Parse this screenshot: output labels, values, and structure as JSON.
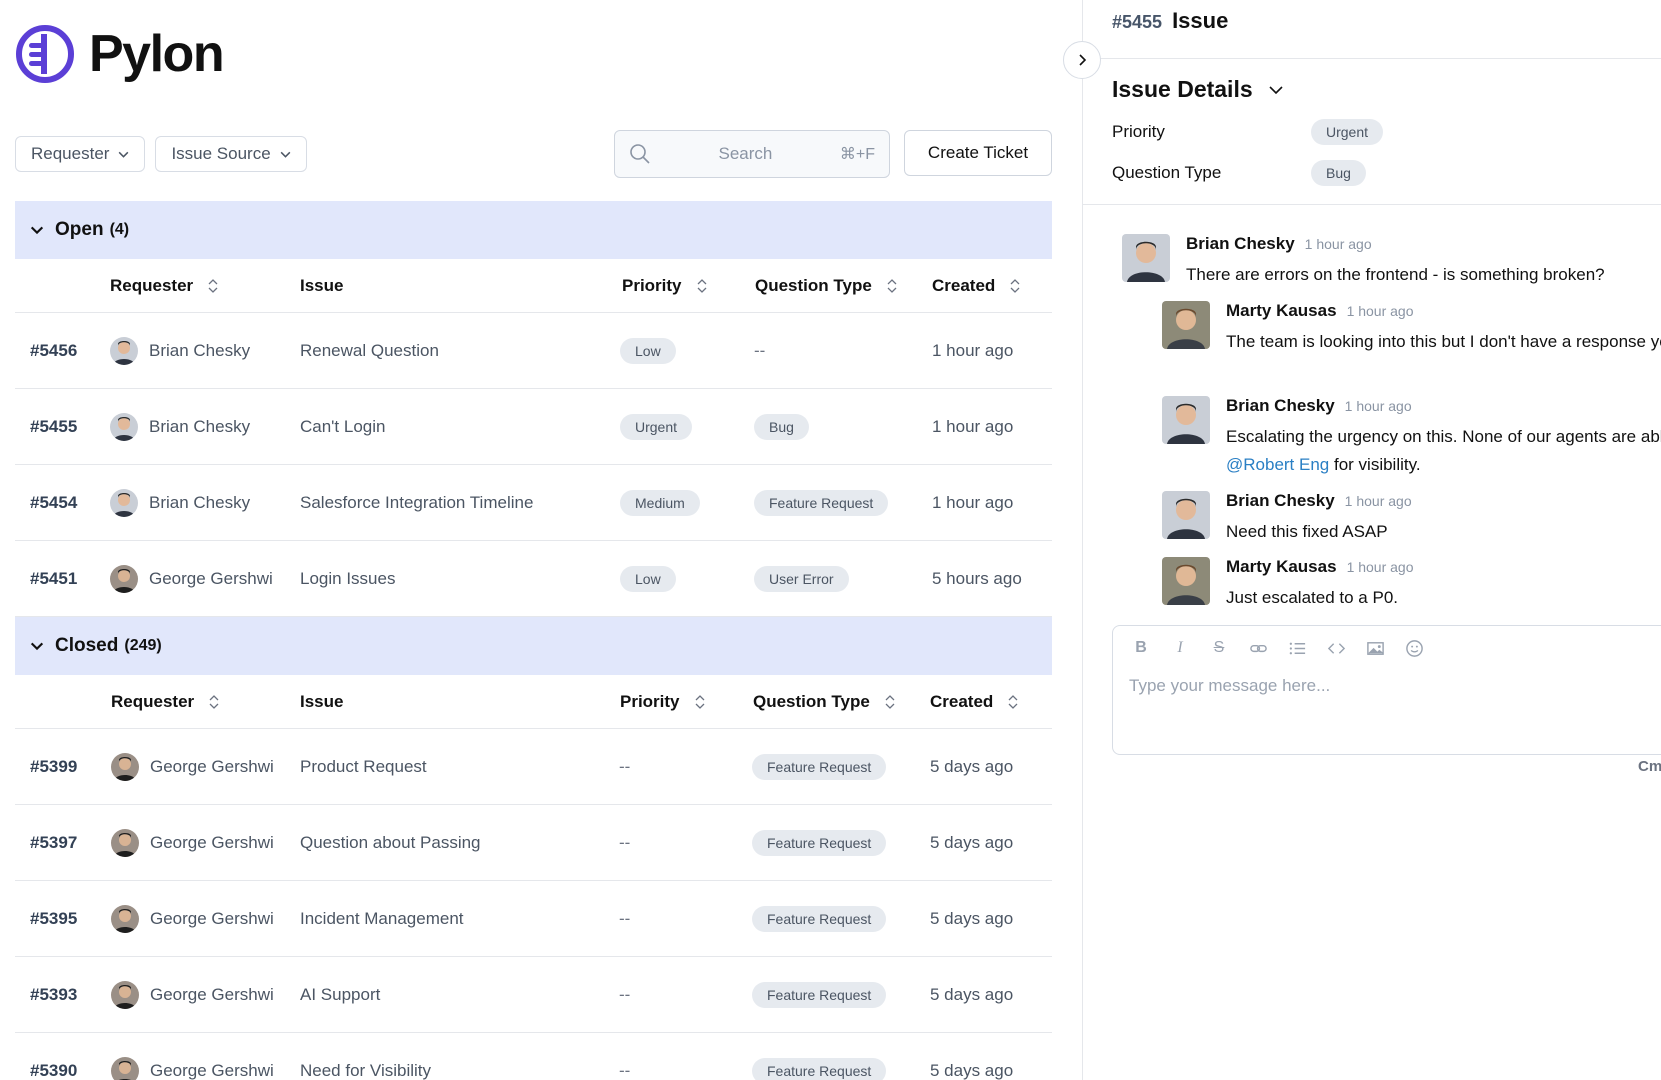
{
  "brand": {
    "name": "Pylon",
    "color": "#5b3fd6"
  },
  "filters": [
    {
      "label": "Requester"
    },
    {
      "label": "Issue Source"
    }
  ],
  "search": {
    "placeholder": "Search",
    "shortcut": "⌘+F"
  },
  "create_button": "Create Ticket",
  "columns": {
    "requester": "Requester",
    "issue": "Issue",
    "priority": "Priority",
    "question_type": "Question Type",
    "created": "Created"
  },
  "groups": {
    "open": {
      "title": "Open",
      "count": "(4)",
      "rows": [
        {
          "id": "#5456",
          "requester": "Brian Chesky",
          "avatar": "brian",
          "issue": "Renewal Question",
          "priority": "Low",
          "question_type": "--",
          "created": "1 hour ago"
        },
        {
          "id": "#5455",
          "requester": "Brian Chesky",
          "avatar": "brian",
          "issue": "Can't Login",
          "priority": "Urgent",
          "question_type": "Bug",
          "created": "1 hour ago"
        },
        {
          "id": "#5454",
          "requester": "Brian Chesky",
          "avatar": "brian",
          "issue": "Salesforce Integration Timeline",
          "priority": "Medium",
          "question_type": "Feature Request",
          "created": "1 hour ago"
        },
        {
          "id": "#5451",
          "requester": "George Gershwi",
          "avatar": "george",
          "issue": "Login Issues",
          "priority": "Low",
          "question_type": "User Error",
          "created": "5 hours ago"
        }
      ]
    },
    "closed": {
      "title": "Closed",
      "count": "(249)",
      "rows": [
        {
          "id": "#5399",
          "requester": "George Gershwi",
          "avatar": "george",
          "issue": "Product Request",
          "priority": "--",
          "question_type": "Feature Request",
          "created": "5 days ago"
        },
        {
          "id": "#5397",
          "requester": "George Gershwi",
          "avatar": "george",
          "issue": "Question about Passing",
          "priority": "--",
          "question_type": "Feature Request",
          "created": "5 days ago"
        },
        {
          "id": "#5395",
          "requester": "George Gershwi",
          "avatar": "george",
          "issue": "Incident Management",
          "priority": "--",
          "question_type": "Feature Request",
          "created": "5 days ago"
        },
        {
          "id": "#5393",
          "requester": "George Gershwi",
          "avatar": "george",
          "issue": "AI Support",
          "priority": "--",
          "question_type": "Feature Request",
          "created": "5 days ago"
        },
        {
          "id": "#5390",
          "requester": "George Gershwi",
          "avatar": "george",
          "issue": "Need for Visibility",
          "priority": "--",
          "question_type": "Feature Request",
          "created": "5 days ago"
        }
      ]
    }
  },
  "detail": {
    "id": "#5455",
    "title": "Issue",
    "section_title": "Issue Details",
    "fields": [
      {
        "label": "Priority",
        "value": "Urgent"
      },
      {
        "label": "Question Type",
        "value": "Bug"
      }
    ],
    "messages": [
      {
        "author": "Brian Chesky",
        "avatar": "brian",
        "time": "1 hour ago",
        "text": "There are errors on the frontend - is something broken?"
      },
      {
        "author": "Marty Kausas",
        "avatar": "marty",
        "time": "1 hour ago",
        "text": "The team is looking into this but I don't have a response yet. Let me check in."
      },
      {
        "author": "Brian Chesky",
        "avatar": "brian",
        "time": "1 hour ago",
        "text_before": "Escalating the urgency on this. None of our agents are able to log in. Tagging ",
        "mention": "@Robert Eng",
        "text_after": " for visibility."
      },
      {
        "author": "Brian Chesky",
        "avatar": "brian",
        "time": "1 hour ago",
        "text": "Need this fixed ASAP"
      },
      {
        "author": "Marty Kausas",
        "avatar": "marty",
        "time": "1 hour ago",
        "text": "Just escalated to a P0."
      }
    ],
    "composer": {
      "placeholder": "Type your message here...",
      "tools": [
        "bold-icon",
        "italic-icon",
        "strikethrough-icon",
        "link-icon",
        "list-icon",
        "code-icon",
        "image-icon",
        "emoji-icon"
      ],
      "hint": "Cm"
    }
  }
}
